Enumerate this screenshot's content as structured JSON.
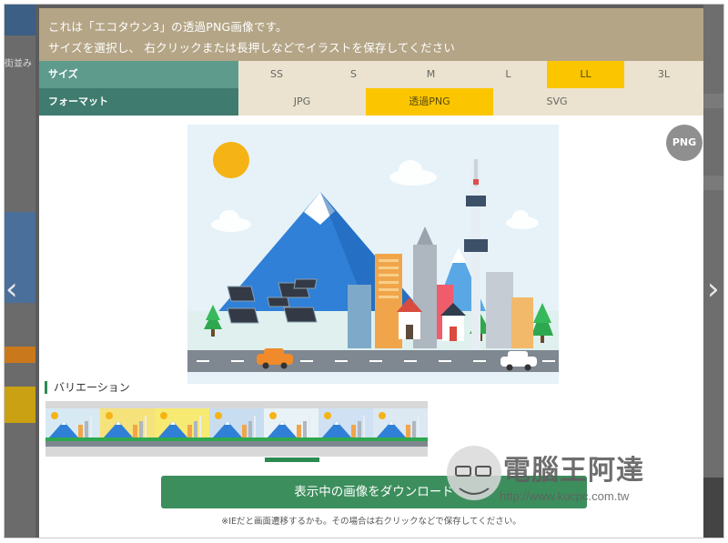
{
  "modal": {
    "header_line1": "これは「エコタウン3」の透過PNG画像です。",
    "header_line2": "サイズを選択し、 右クリックまたは長押しなどでイラストを保存してください"
  },
  "size_row": {
    "label": "サイズ",
    "options": [
      "SS",
      "S",
      "M",
      "L",
      "LL",
      "3L"
    ],
    "selected": "LL"
  },
  "format_row": {
    "label": "フォーマット",
    "options": [
      "JPG",
      "透過PNG",
      "SVG"
    ],
    "selected": "透過PNG"
  },
  "format_badge": "PNG",
  "variation": {
    "title": "バリエーション",
    "thumb_skies": [
      "#d7e9f3",
      "#f6e27a",
      "#f7ea73",
      "#c8ddf0",
      "#e9f2f6",
      "#cfe1f2",
      "#dce8f2"
    ],
    "selected_index": 4
  },
  "download_label": "表示中の画像をダウンロード",
  "note": "※IEだと画面遷移するかも。その場合は右クリックなどで保存してください。",
  "watermark": {
    "title": "電腦王阿達",
    "url": "http://www.kocpc.com.tw"
  },
  "background": {
    "left_text": "街並み",
    "prev_arrow": "‹",
    "next_arrow": "›"
  },
  "colors": {
    "header": "#b4a586",
    "size_label_bg": "#5e9b8d",
    "format_label_bg": "#3f7b6f",
    "option_bg": "#ebe3cf",
    "selected_bg": "#fbc600",
    "download_bg": "#3c8f5d"
  }
}
